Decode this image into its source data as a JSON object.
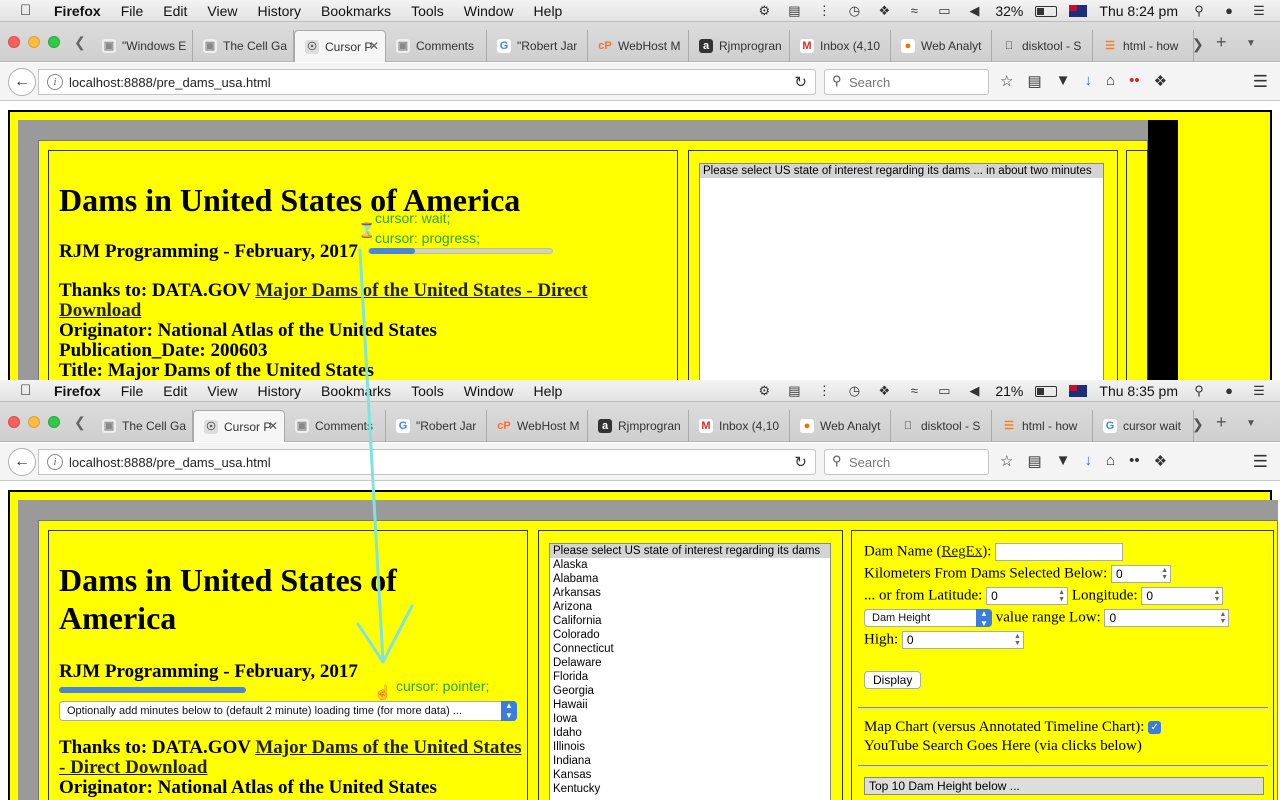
{
  "menubar_top": {
    "app": "Firefox",
    "menus": [
      "File",
      "Edit",
      "View",
      "History",
      "Bookmarks",
      "Tools",
      "Window",
      "Help"
    ],
    "battery": "32%",
    "clock": "Thu 8:24 pm"
  },
  "menubar_bottom": {
    "app": "Firefox",
    "menus": [
      "File",
      "Edit",
      "View",
      "History",
      "Bookmarks",
      "Tools",
      "Window",
      "Help"
    ],
    "battery": "21%",
    "clock": "Thu 8:35 pm"
  },
  "tabs_top": [
    {
      "label": "\"Windows E",
      "icon": "page-icon"
    },
    {
      "label": "The Cell Ga",
      "icon": "page-icon"
    },
    {
      "label": "Cursor P",
      "icon": "globe-icon",
      "active": true
    },
    {
      "label": "Comments",
      "icon": "page-icon"
    },
    {
      "label": "\"Robert Jar",
      "icon": "google-icon"
    },
    {
      "label": "WebHost M",
      "icon": "cpanel-icon"
    },
    {
      "label": "Rjmprogran",
      "icon": "a-icon"
    },
    {
      "label": "Inbox (4,10",
      "icon": "gmail-icon"
    },
    {
      "label": "Web Analyt",
      "icon": "analytics-icon"
    },
    {
      "label": "disktool - S",
      "icon": "apple-icon"
    },
    {
      "label": "html - how",
      "icon": "stack-icon"
    }
  ],
  "tabs_bottom": [
    {
      "label": "The Cell Ga",
      "icon": "page-icon"
    },
    {
      "label": "Cursor P",
      "icon": "globe-icon",
      "active": true
    },
    {
      "label": "Comments",
      "icon": "page-icon"
    },
    {
      "label": "\"Robert Jar",
      "icon": "google-icon"
    },
    {
      "label": "WebHost M",
      "icon": "cpanel-icon"
    },
    {
      "label": "Rjmprogran",
      "icon": "a-icon"
    },
    {
      "label": "Inbox (4,10",
      "icon": "gmail-icon"
    },
    {
      "label": "Web Analyt",
      "icon": "analytics-icon"
    },
    {
      "label": "disktool - S",
      "icon": "apple-icon"
    },
    {
      "label": "html - how",
      "icon": "stack-icon"
    },
    {
      "label": "cursor wait",
      "icon": "google-icon"
    }
  ],
  "nav": {
    "url": "localhost:8888/pre_dams_usa.html",
    "search_placeholder": "Search"
  },
  "page": {
    "title": "Dams in United States of America",
    "title_line1": "Dams in United States of",
    "title_line2": "America",
    "byline": "RJM Programming - February, 2017",
    "thanks_prefix": "Thanks to: DATA.GOV ",
    "thanks_link": "Major Dams of the United States - Direct Download",
    "thanks_link_part1": "Major Dams of the United States",
    "thanks_link_part2": "- Direct Download",
    "originator": "Originator: National Atlas of the United States",
    "pubdate": "Publication_Date: 200603",
    "doc_title": "Title: Major Dams of the United States",
    "loading_select": "Optionally add minutes below to (default 2 minute) loading time (for more data) ...",
    "state_prompt_loading": "Please select US state of interest regarding its dams ... in about two minutes",
    "state_prompt": "Please select US state of interest regarding its dams",
    "states": [
      "Alaska",
      "Alabama",
      "Arkansas",
      "Arizona",
      "California",
      "Colorado",
      "Connecticut",
      "Delaware",
      "Florida",
      "Georgia",
      "Hawaii",
      "Iowa",
      "Idaho",
      "Illinois",
      "Indiana",
      "Kansas",
      "Kentucky"
    ]
  },
  "annotations": {
    "wait": "cursor: wait;",
    "progress": "cursor: progress;",
    "pointer": "cursor: pointer;"
  },
  "form": {
    "dam_name_label": "Dam Name (",
    "regex_link": "RegEx",
    "dam_name_suffix": "):",
    "km_label": "Kilometers From Dams Selected Below:",
    "km_value": "0",
    "lat_label": "... or from Latitude:",
    "lat_value": "0",
    "lon_label": "Longitude:",
    "lon_value": "0",
    "metric_select": "Dam Height",
    "range_low_label": "value range Low:",
    "low_value": "0",
    "high_label": "High:",
    "high_value": "0",
    "display_button": "Display",
    "map_chart_label": "Map Chart (versus Annotated Timeline Chart):",
    "youtube_label": "YouTube Search Goes Here (via clicks below)",
    "top10_label": "Top 10 Dam Height below ..."
  },
  "colors": {
    "page_bg": "#ffff00",
    "annotation": "#2aa24a",
    "arrow": "#7fe3e0",
    "progress": "#4a86d8"
  },
  "progress": {
    "top_fraction": 0.25,
    "bottom_fraction": 0.97
  }
}
